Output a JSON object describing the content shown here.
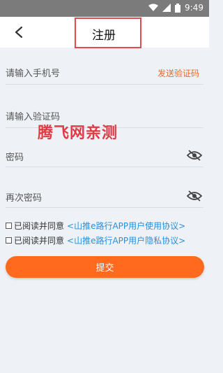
{
  "status_bar": {
    "time": "9:49"
  },
  "header": {
    "title": "注册"
  },
  "form": {
    "phone_label": "请输入手机号",
    "send_code_label": "发送验证码",
    "code_label": "请输入验证码",
    "password_label": "密码",
    "confirm_password_label": "再次密码"
  },
  "watermark": "腾飞网亲测",
  "agreements": [
    {
      "prefix": "已阅读并同意",
      "link": "<山推e路行APP用户使用协议>"
    },
    {
      "prefix": "已阅读并同意",
      "link": "<山推e路行APP用户隐私协议>"
    }
  ],
  "submit_label": "提交",
  "colors": {
    "accent": "#ff6a1e",
    "link": "#2b8fd9",
    "code_link": "#e86a2a"
  }
}
